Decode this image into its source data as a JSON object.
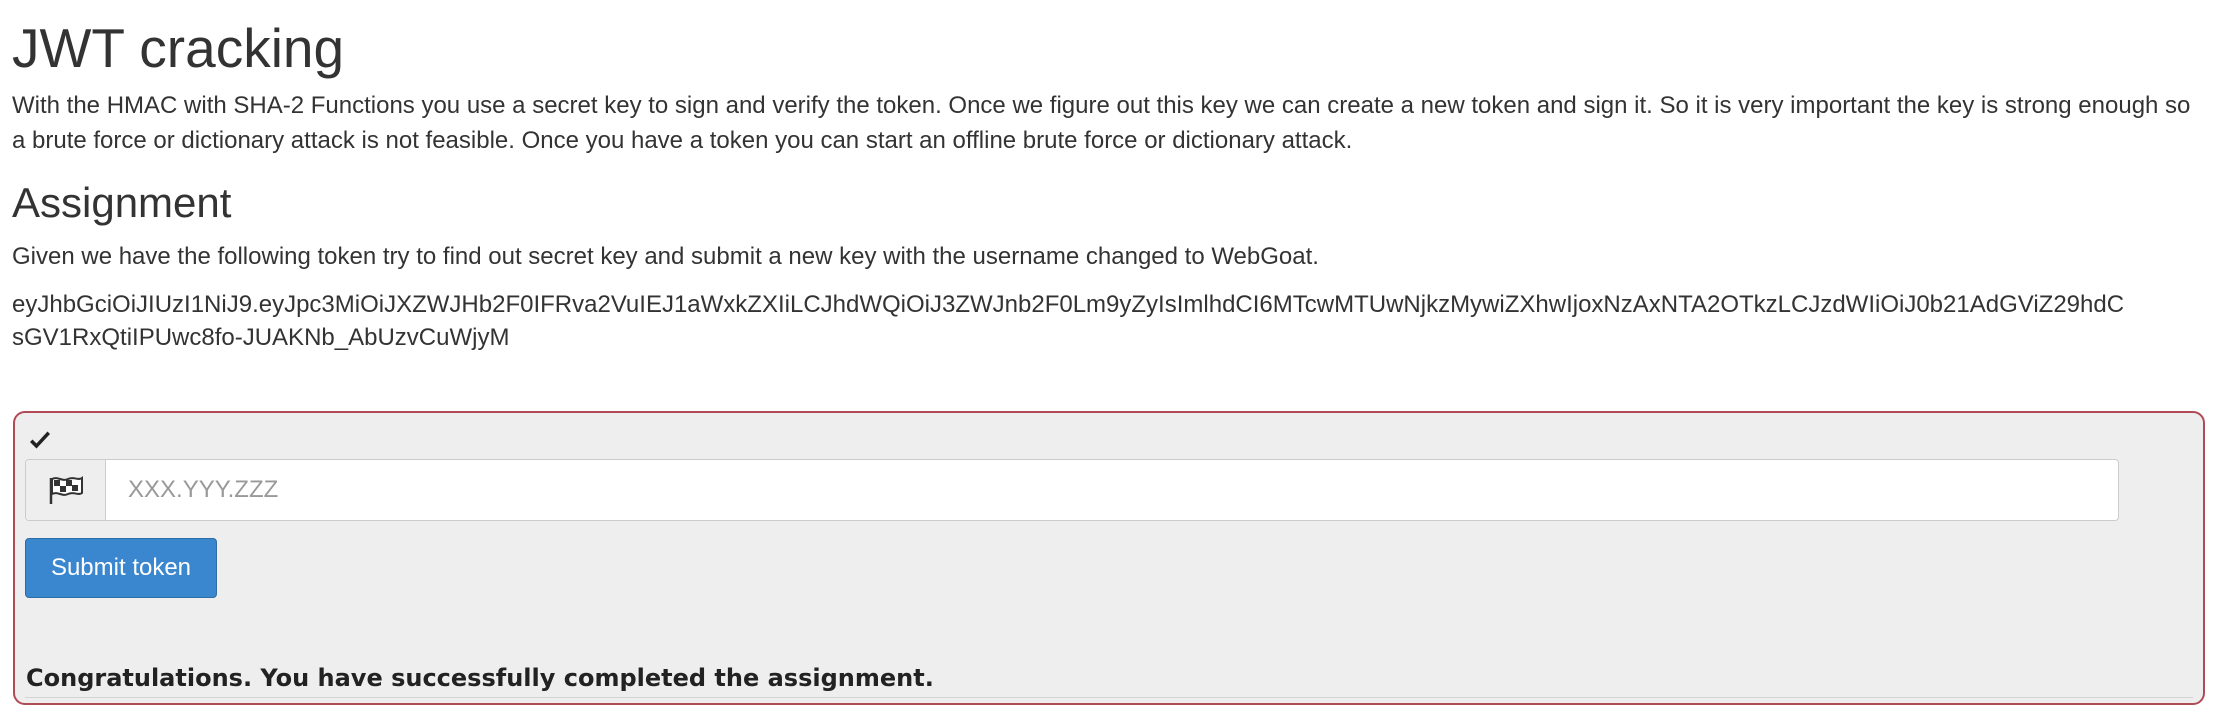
{
  "lesson": {
    "title": "JWT cracking",
    "intro": "With the HMAC with SHA-2 Functions you use a secret key to sign and verify the token. Once we figure out this key we can create a new token and sign it. So it is very important the key is strong enough so a brute force or dictionary attack is not feasible. Once you have a token you can start an offline brute force or dictionary attack."
  },
  "assignment": {
    "title": "Assignment",
    "description": "Given we have the following token try to find out secret key and submit a new key with the username changed to WebGoat.",
    "token_line1": "eyJhbGciOiJIUzI1NiJ9.eyJpc3MiOiJXZWJHb2F0IFRva2VuIEJ1aWxkZXIiLCJhdWQiOiJ3ZWJnb2F0Lm9yZyIsImlhdCI6MTcwMTUwNjkzMywiZXhwIjoxNzAxNTA2OTkzLCJzdWIiOiJ0b21AdGViZ29hdC",
    "token_line2": "sGV1RxQtiIPUwc8fo-JUAKNb_AbUzvCuWjyM"
  },
  "form": {
    "status_icon": "check-icon",
    "addon_icon": "flag-checkered-icon",
    "input_value": "",
    "input_placeholder": "XXX.YYY.ZZZ",
    "submit_label": "Submit token",
    "feedback": "Congratulations. You have successfully completed the assignment."
  },
  "colors": {
    "container_border": "#b14a57",
    "container_background": "#eeeeee",
    "button_primary": "#3a87cf",
    "text": "#333333"
  }
}
